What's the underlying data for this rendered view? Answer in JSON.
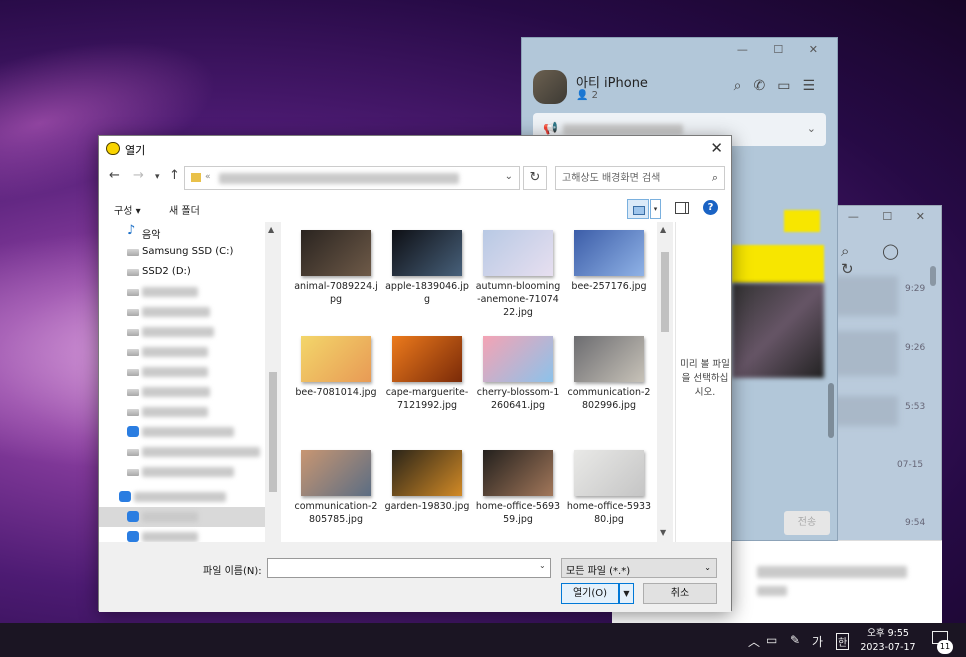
{
  "chat_back": {
    "times": [
      "9:29",
      "9:26",
      "5:53",
      "07-15",
      "9:54"
    ]
  },
  "chat": {
    "title": "아티 iPhone",
    "member_count": "2",
    "send_label": "전송"
  },
  "dialog": {
    "title": "열기",
    "search_placeholder": "고해상도 배경화면 검색",
    "organize_label": "구성 ▾",
    "new_folder_label": "새 폴더",
    "help_label": "?",
    "nav_items": [
      {
        "label": "음악",
        "icon": "music-icon"
      },
      {
        "label": "Samsung SSD (C:)",
        "icon": "drive-icon"
      },
      {
        "label": "SSD2 (D:)",
        "icon": "drive-icon"
      }
    ],
    "files": [
      {
        "name": "animal-7089224.jpg",
        "colors": [
          "#2a2420",
          "#6e5a48"
        ]
      },
      {
        "name": "apple-1839046.jpg",
        "colors": [
          "#0e0f14",
          "#47607a"
        ]
      },
      {
        "name": "autumn-blooming-anemone-7107422.jpg",
        "colors": [
          "#b8c9e4",
          "#e7dff0"
        ]
      },
      {
        "name": "bee-257176.jpg",
        "colors": [
          "#3c5da8",
          "#8fb2e6"
        ]
      },
      {
        "name": "bee-7081014.jpg",
        "colors": [
          "#f3d66a",
          "#e89a55"
        ]
      },
      {
        "name": "cape-marguerite-7121992.jpg",
        "colors": [
          "#ec7a1c",
          "#7a2a08"
        ]
      },
      {
        "name": "cherry-blossom-1260641.jpg",
        "colors": [
          "#f4a3b4",
          "#8cc2ea"
        ]
      },
      {
        "name": "communication-2802996.jpg",
        "colors": [
          "#6c6c70",
          "#c7c2b8"
        ]
      },
      {
        "name": "communication-2805785.jpg",
        "colors": [
          "#c89672",
          "#5b6d83"
        ]
      },
      {
        "name": "garden-19830.jpg",
        "colors": [
          "#2a2418",
          "#d28a26"
        ]
      },
      {
        "name": "home-office-569359.jpg",
        "colors": [
          "#23201d",
          "#a2775a"
        ]
      },
      {
        "name": "home-office-593380.jpg",
        "colors": [
          "#e9e9e7",
          "#c5c5c5"
        ]
      }
    ],
    "preview_message": "미리 볼 파일을 선택하십시오.",
    "filename_label": "파일 이름(N):",
    "filename_value": "",
    "filetype_value": "모든 파일 (*.*)",
    "open_label": "열기(O)",
    "cancel_label": "취소"
  },
  "taskbar": {
    "ime": "가",
    "ime2": "한",
    "time_line1": "오후 9:55",
    "time_line2": "2023-07-17",
    "notifications": "11"
  }
}
